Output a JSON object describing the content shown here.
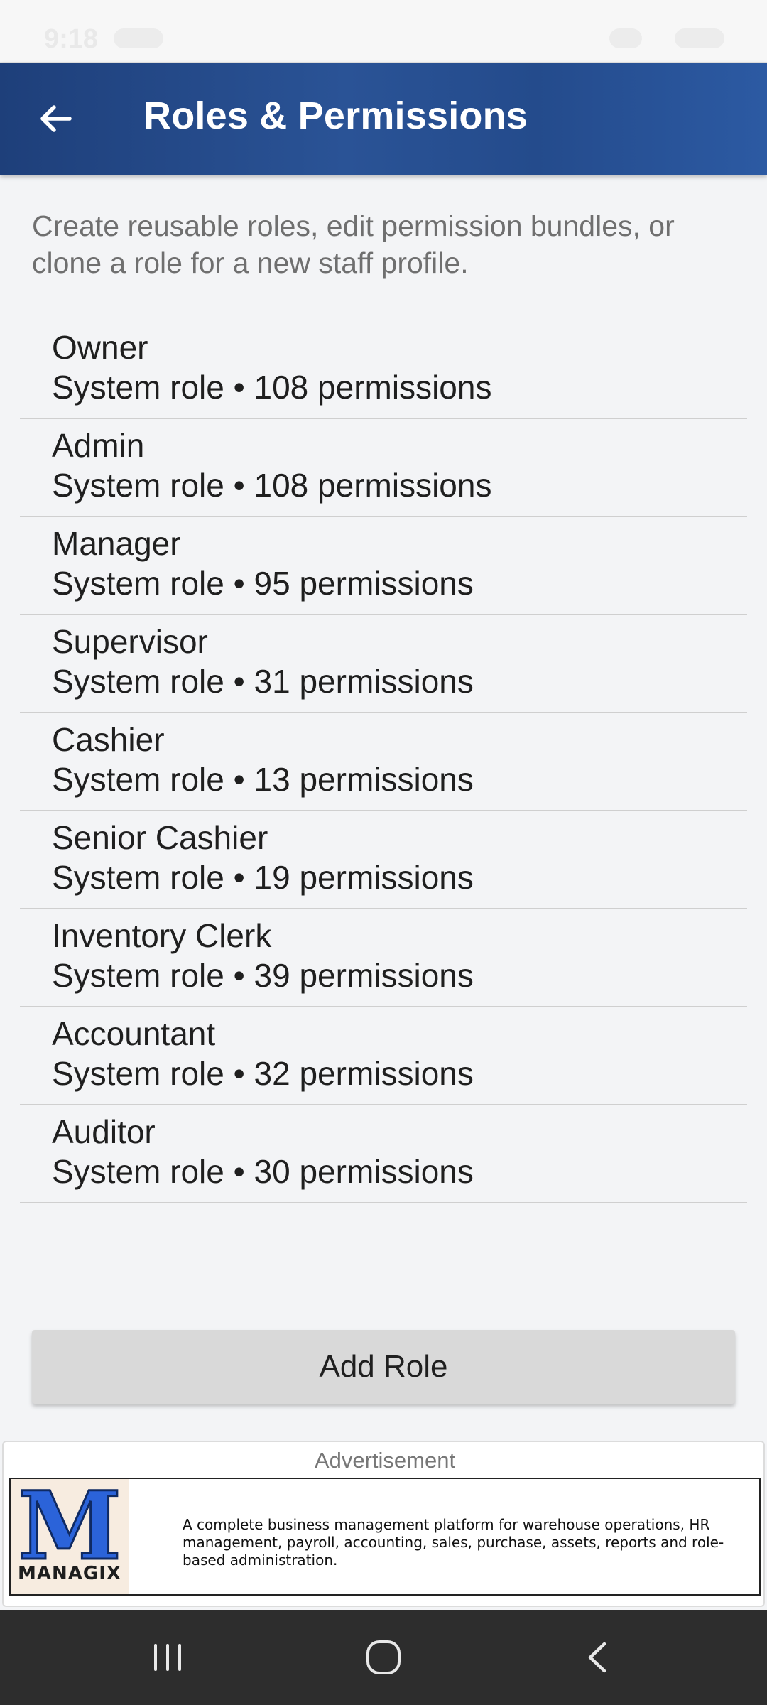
{
  "status_bar": {
    "time": "9:18"
  },
  "app_bar": {
    "title": "Roles & Permissions",
    "back_icon": "arrow-left-icon",
    "background_color": "#23498a"
  },
  "description": "Create reusable roles, edit permission bundles, or clone a role for a new staff profile.",
  "roles": [
    {
      "name": "Owner",
      "meta": "System role • 108 permissions"
    },
    {
      "name": "Admin",
      "meta": "System role • 108 permissions"
    },
    {
      "name": "Manager",
      "meta": "System role • 95 permissions"
    },
    {
      "name": "Supervisor",
      "meta": "System role • 31 permissions"
    },
    {
      "name": "Cashier",
      "meta": "System role • 13 permissions"
    },
    {
      "name": "Senior Cashier",
      "meta": "System role • 19 permissions"
    },
    {
      "name": "Inventory Clerk",
      "meta": "System role • 39 permissions"
    },
    {
      "name": "Accountant",
      "meta": "System role • 32 permissions"
    },
    {
      "name": "Auditor",
      "meta": "System role • 30 permissions"
    }
  ],
  "add_role_label": "Add Role",
  "advertisement": {
    "label": "Advertisement",
    "logo_letter": "M",
    "logo_word": "MANAGIX",
    "text": "A complete business management platform for warehouse operations, HR management, payroll, accounting, sales, purchase, assets, reports and role-based administration."
  },
  "nav_bar": {
    "recents_icon": "recent-apps-icon",
    "home_icon": "home-circle-icon",
    "back_icon": "back-chevron-icon"
  }
}
